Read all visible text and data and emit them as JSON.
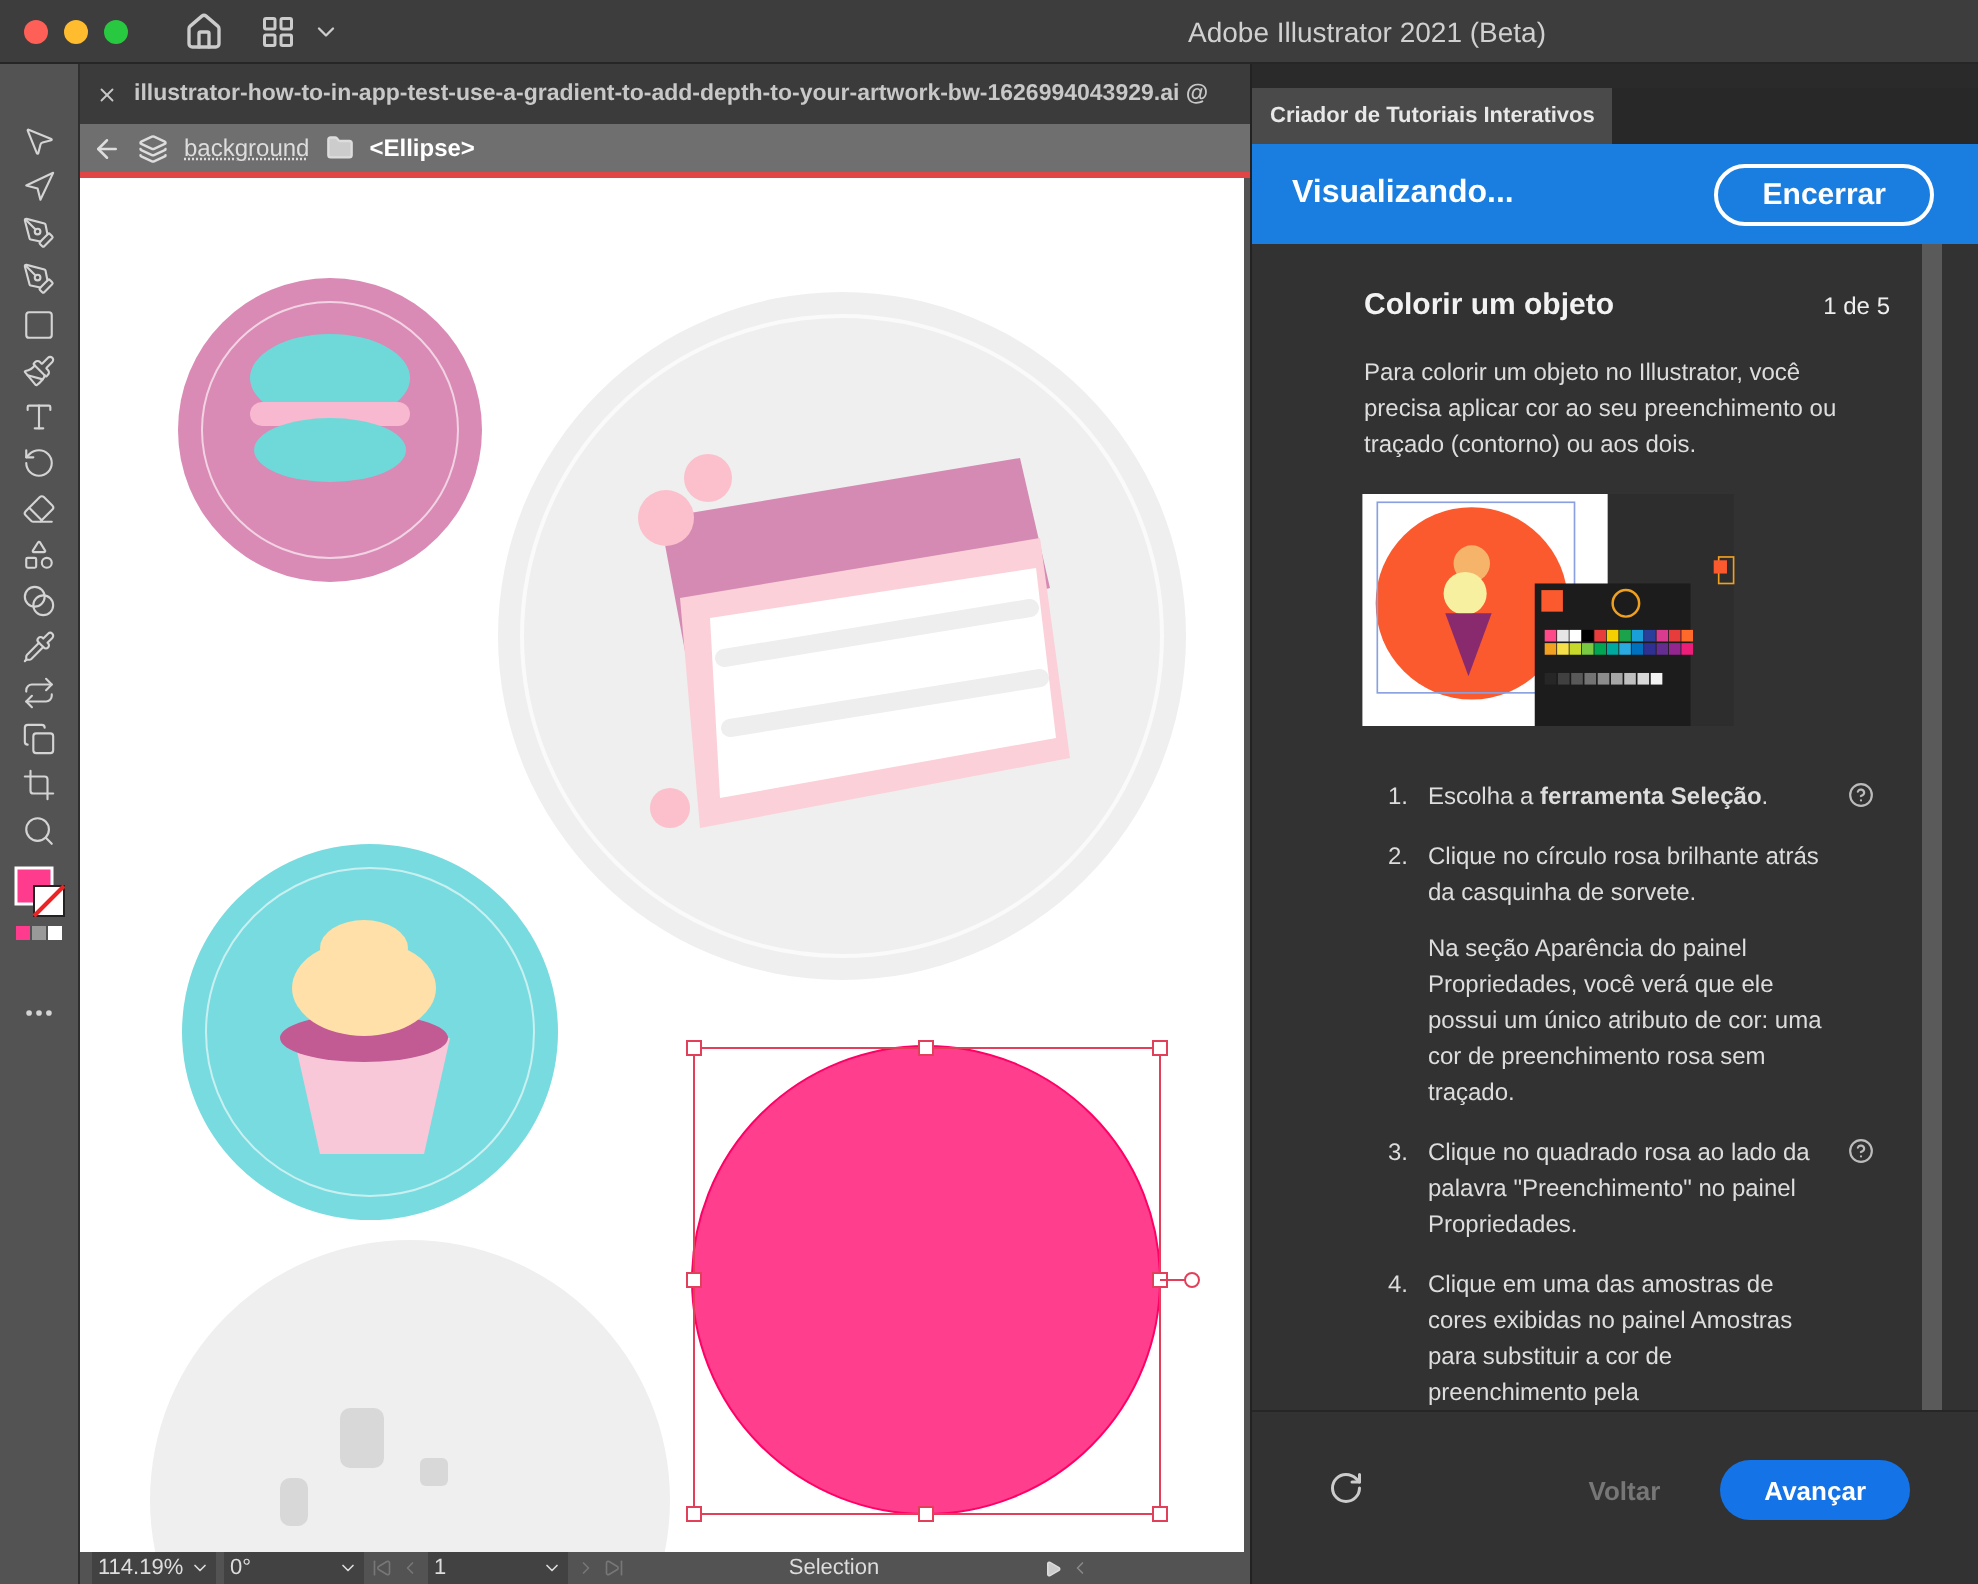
{
  "window": {
    "title": "Adobe Illustrator 2021 (Beta)"
  },
  "document_tab": {
    "title": "illustrator-how-to-in-app-test-use-a-gradient-to-add-depth-to-your-artwork-bw-1626994043929.ai @"
  },
  "breadcrumb": {
    "layer": "background",
    "object": "<Ellipse>"
  },
  "status_bar": {
    "zoom": "114.19%",
    "rotation": "0°",
    "artboard": "1",
    "tool": "Selection"
  },
  "panel": {
    "tab": "Criador de Tutoriais Interativos",
    "status": "Visualizando...",
    "end_button": "Encerrar",
    "step_title": "Colorir um objeto",
    "step_counter": "1 de 5",
    "intro": "Para colorir um objeto no Illustrator, você precisa aplicar cor ao seu preenchimento ou traçado (contorno) ou aos dois.",
    "steps": [
      {
        "number": "1.",
        "paragraphs": [
          "Escolha a **ferramenta Seleção**."
        ],
        "help": true
      },
      {
        "number": "2.",
        "paragraphs": [
          "Clique no círculo rosa brilhante atrás da casquinha de sorvete.",
          "Na seção Aparência do painel Propriedades, você verá que ele possui um único atributo de cor: uma cor de preenchimento rosa sem traçado."
        ],
        "help": false
      },
      {
        "number": "3.",
        "paragraphs": [
          "Clique no quadrado rosa ao lado da palavra \"Preenchimento\" no painel Propriedades."
        ],
        "help": true
      },
      {
        "number": "4.",
        "paragraphs": [
          "Clique em uma das amostras de cores exibidas no painel Amostras para substituir a cor de preenchimento pela"
        ],
        "help": false
      }
    ],
    "back_button": {
      "label": "Voltar",
      "disabled": true
    },
    "next_button": {
      "label": "Avançar",
      "disabled": false
    }
  }
}
